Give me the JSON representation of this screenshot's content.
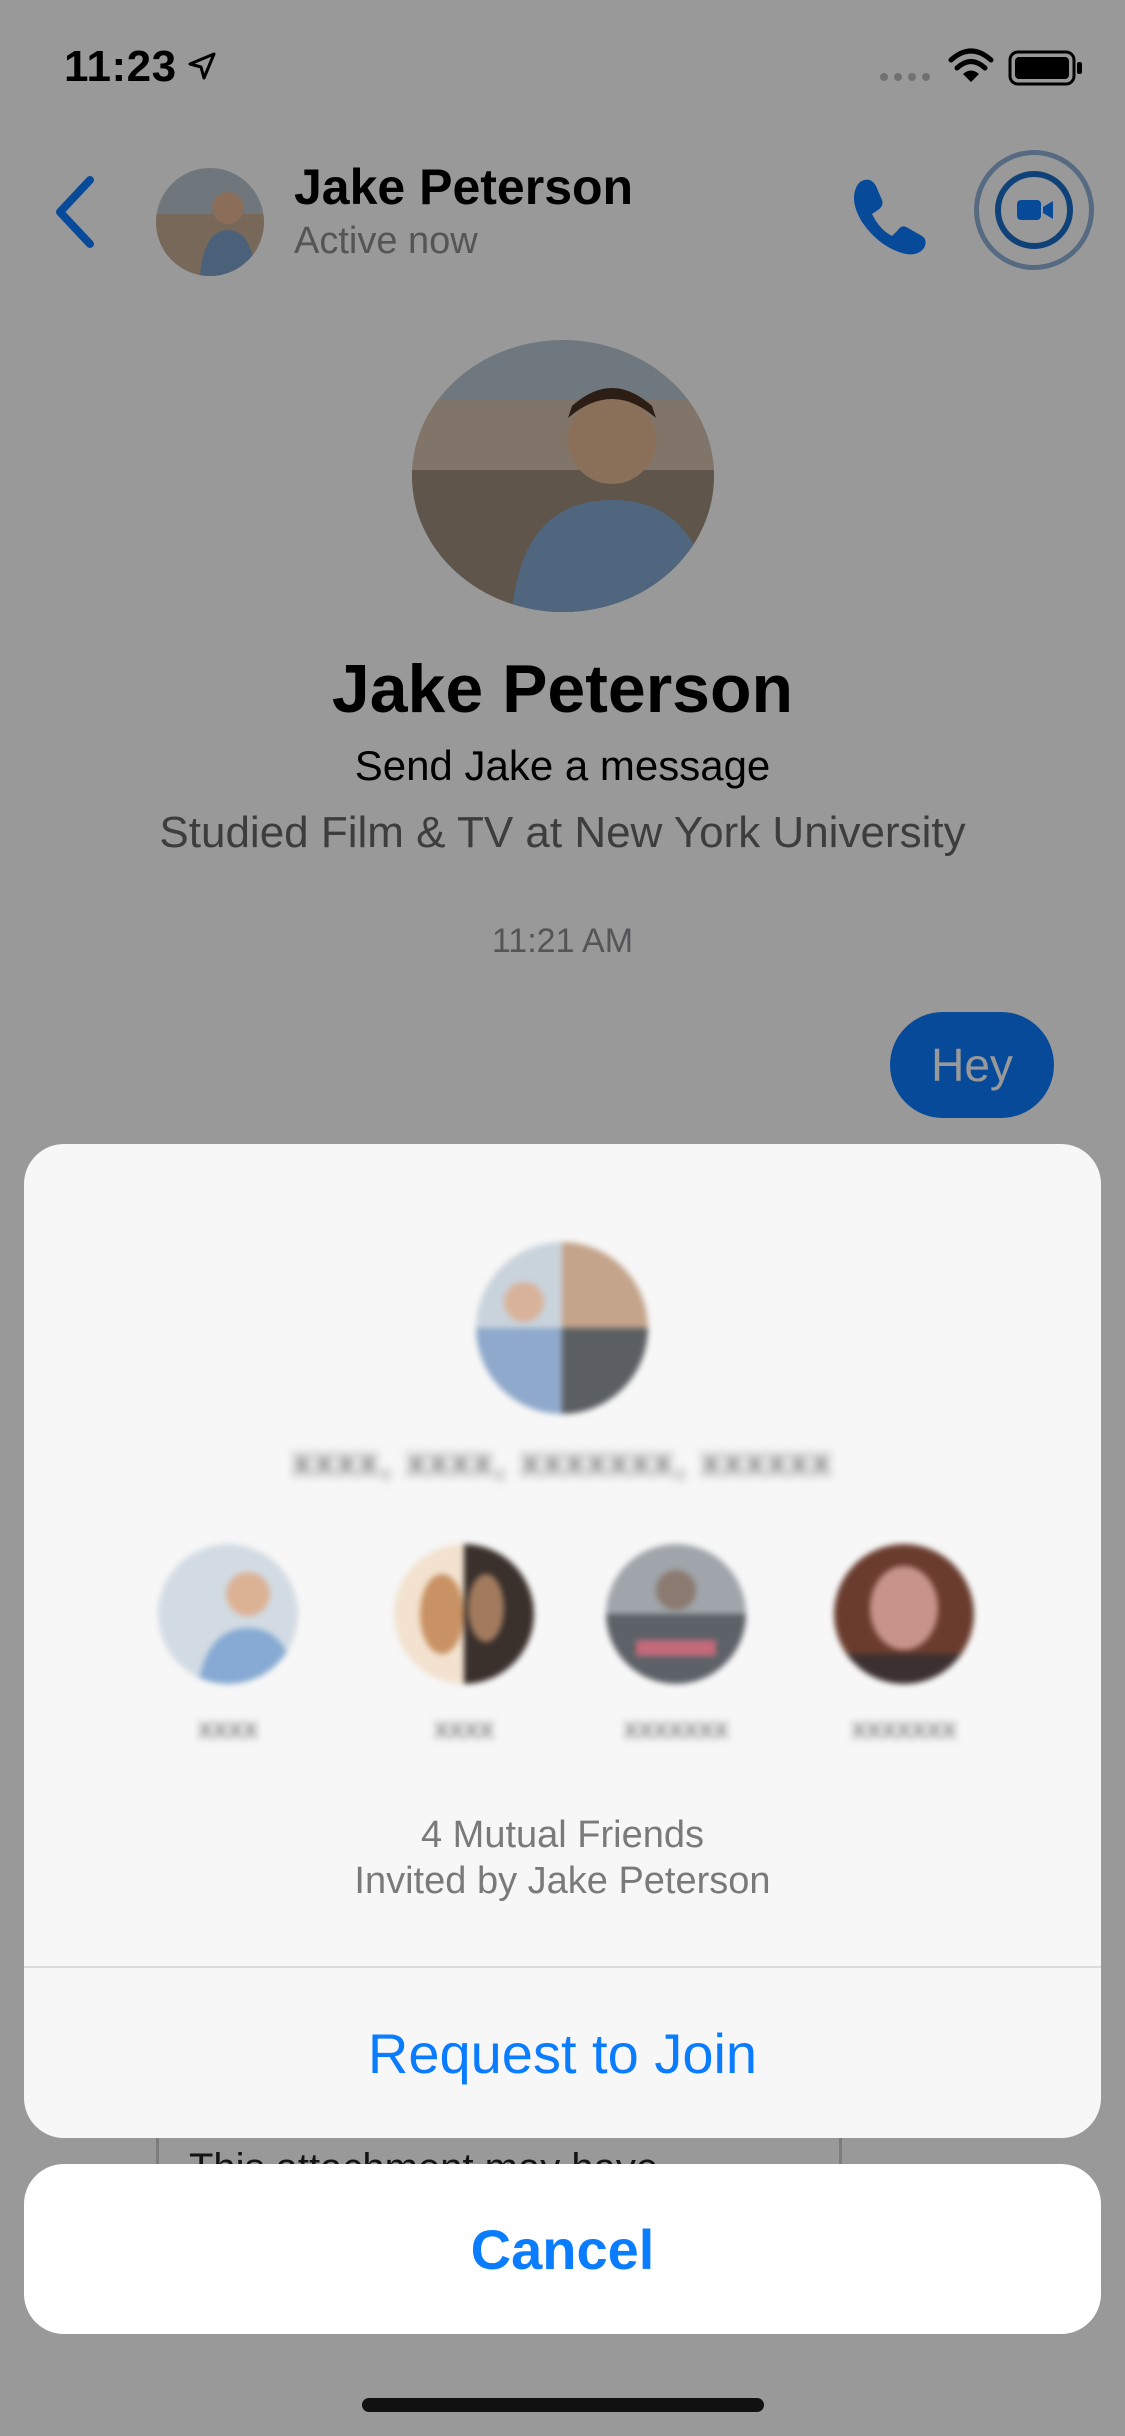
{
  "status_bar": {
    "time": "11:23"
  },
  "header": {
    "contact_name": "Jake Peterson",
    "contact_status": "Active now"
  },
  "profile": {
    "name": "Jake Peterson",
    "subtitle": "Send Jake a message",
    "education": "Studied Film & TV at New York University"
  },
  "conversation": {
    "timestamp": "11:21 AM",
    "messages": [
      {
        "from": "me",
        "text": "Hey"
      }
    ],
    "attachment_preview": "This attachment may have"
  },
  "sheet": {
    "group_name": "xxxx, xxxx, xxxxxxx, xxxxxx",
    "friends": [
      {
        "name": "xxxx"
      },
      {
        "name": "xxxx"
      },
      {
        "name": "xxxxxxx"
      },
      {
        "name": "xxxxxxx"
      }
    ],
    "mutual_friends": "4 Mutual Friends",
    "invited_by": "Invited by Jake Peterson",
    "request_label": "Request to Join"
  },
  "cancel_label": "Cancel",
  "colors": {
    "accent": "#0a7cff",
    "overlay": "rgba(0,0,0,0.4)"
  },
  "icons": [
    "back-chevron-icon",
    "phone-icon",
    "video-camera-icon",
    "location-arrow-icon",
    "signal-icon",
    "wifi-icon",
    "battery-icon"
  ]
}
